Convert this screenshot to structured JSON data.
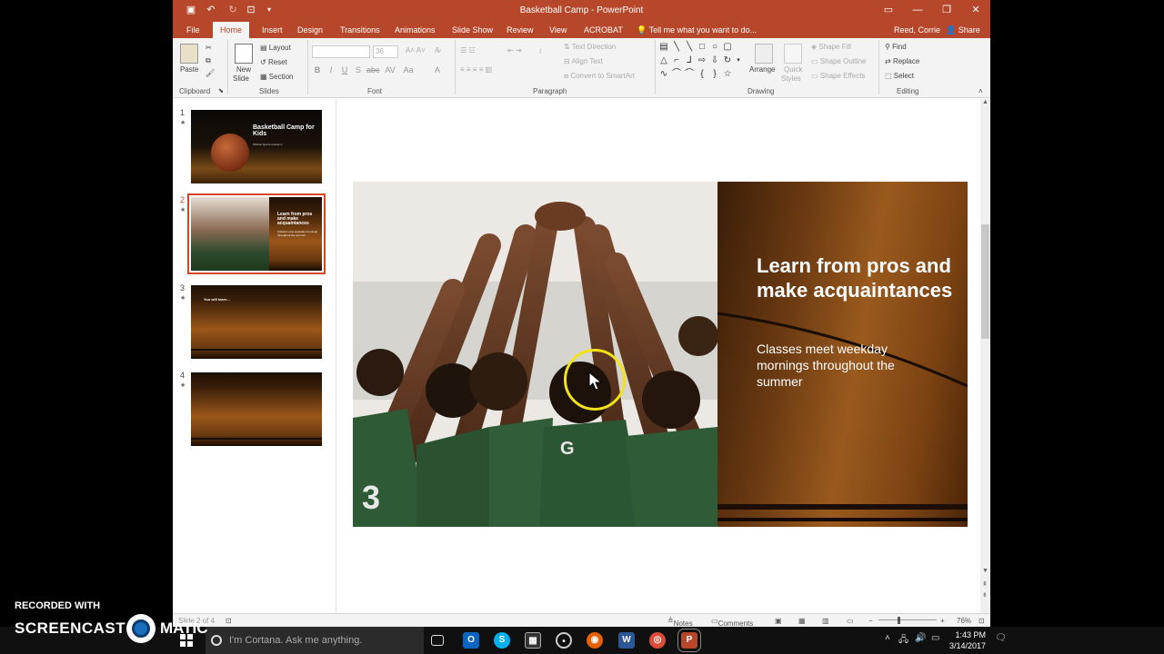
{
  "window": {
    "title": "Basketball Camp - PowerPoint",
    "controls": [
      "ribbon-display",
      "minimize",
      "restore",
      "close"
    ]
  },
  "quick_access": [
    "save-icon",
    "undo-icon",
    "redo-icon",
    "present-icon",
    "customize-icon"
  ],
  "tabs": [
    "File",
    "Home",
    "Insert",
    "Design",
    "Transitions",
    "Animations",
    "Slide Show",
    "Review",
    "View",
    "ACROBAT"
  ],
  "active_tab": "Home",
  "tell_me": "Tell me what you want to do...",
  "user": "Reed, Corrie",
  "share": "Share",
  "ribbon": {
    "clipboard": {
      "label": "Clipboard",
      "paste": "Paste"
    },
    "slides": {
      "label": "Slides",
      "new_slide": "New",
      "new_slide_2": "Slide",
      "layout": "Layout",
      "reset": "Reset",
      "section": "Section"
    },
    "font": {
      "label": "Font",
      "size": "36"
    },
    "paragraph": {
      "label": "Paragraph",
      "text_direction": "Text Direction",
      "align_text": "Align Text",
      "convert": "Convert to SmartArt"
    },
    "drawing": {
      "label": "Drawing",
      "arrange": "Arrange",
      "quick_styles": "Quick",
      "quick_styles_2": "Styles",
      "shape_fill": "Shape Fill",
      "shape_outline": "Shape Outline",
      "shape_effects": "Shape Effects"
    },
    "editing": {
      "label": "Editing",
      "find": "Find",
      "replace": "Replace",
      "select": "Select"
    }
  },
  "thumbnails": [
    {
      "num": "1",
      "title": "Basketball Camp for Kids",
      "subtitle": "Wildcat Sports Academy"
    },
    {
      "num": "2",
      "title": "Learn from pros and make acquaintances",
      "subtitle": "Classes meet weekday mornings throughout the summer"
    },
    {
      "num": "3",
      "title": "You will learn...",
      "subtitle": ""
    },
    {
      "num": "4",
      "title": "",
      "subtitle": ""
    }
  ],
  "slide": {
    "title": "Learn from pros and make acquaintances",
    "subtitle": "Classes meet weekday mornings throughout the summer"
  },
  "status": {
    "slide_info": "Slide 2 of 4",
    "notes": "Notes",
    "comments": "Comments",
    "zoom": "76%"
  },
  "taskbar": {
    "cortana": "I'm Cortana. Ask me anything.",
    "time": "1:43 PM",
    "date": "3/14/2017"
  },
  "watermark": {
    "line1": "RECORDED WITH",
    "line2": "SCREENCAST",
    "line2b": "MATIC"
  }
}
